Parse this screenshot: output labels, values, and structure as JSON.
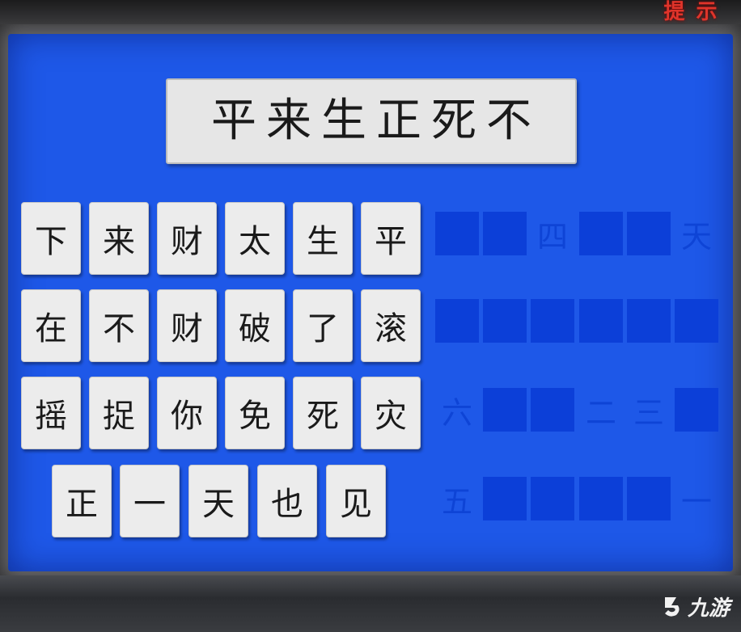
{
  "hint_button": "提示",
  "clue": [
    "平",
    "来",
    "生",
    "正",
    "死",
    "不"
  ],
  "tile_rows": [
    [
      "下",
      "来",
      "财",
      "太",
      "生",
      "平"
    ],
    [
      "在",
      "不",
      "财",
      "破",
      "了",
      "滚"
    ],
    [
      "摇",
      "捉",
      "你",
      "免",
      "死",
      "灾"
    ],
    [
      "正",
      "一",
      "天",
      "也",
      "见"
    ]
  ],
  "answer_rows": [
    [
      "",
      "",
      "四",
      "",
      "",
      "天"
    ],
    [
      "",
      "",
      "",
      "",
      "",
      ""
    ],
    [
      "六",
      "",
      "",
      "二",
      "三",
      ""
    ],
    [
      "五",
      "",
      "",
      "",
      "",
      "一"
    ]
  ],
  "watermark": "九游",
  "colors": {
    "board": "#1e58e8",
    "slot": "#0c3fd8",
    "hint": "#e0342a",
    "tile": "#ececec"
  }
}
